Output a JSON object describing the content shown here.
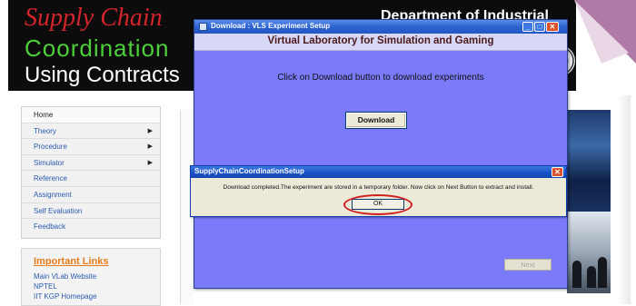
{
  "banner": {
    "line1": "Supply Chain",
    "line2": "Coordination",
    "line3": "Using Contracts",
    "department": "Department of Industrial"
  },
  "nav": {
    "items": [
      {
        "label": "Home"
      },
      {
        "label": "Theory"
      },
      {
        "label": "Procedure"
      },
      {
        "label": "Simulator"
      },
      {
        "label": "Reference"
      },
      {
        "label": "Assignment"
      },
      {
        "label": "Self Evaluation"
      },
      {
        "label": "Feedback"
      }
    ],
    "arrow": "▶"
  },
  "important_links": {
    "title": "Important Links",
    "links": [
      "Main VLab Website",
      "NPTEL",
      "IIT KGP Homepage"
    ]
  },
  "download_dialog": {
    "title": "Download : VLS Experiment Setup",
    "header": "Virtual Laboratory for Simulation and Gaming",
    "instruction": "Click on Download button to download experiments",
    "download_label": "Download",
    "next_label": "Next",
    "minimize_icon": "_",
    "maximize_icon": "□",
    "close_icon": "✕"
  },
  "message_box": {
    "title": "SupplyChainCoordinationSetup",
    "message": "Download completed.The experiment are stored in a temporary folder. Now click on Next Button to extract and install.",
    "ok_label": "OK",
    "close_icon": "✕"
  },
  "colors": {
    "dialog_body": "#7b7bfa",
    "titlebar": "#2c63d1",
    "message_body": "#ece9d8",
    "highlight_circle": "#d11e1e",
    "banner_red": "#d3242c",
    "banner_green": "#4ccf3a"
  }
}
